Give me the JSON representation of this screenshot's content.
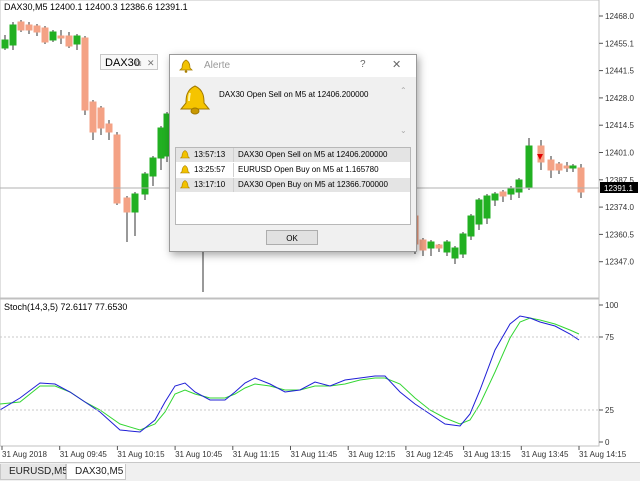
{
  "chart_header": "DAX30,M5  12400.1 12400.3 12386.6 12391.1",
  "price_axis": {
    "ticks": [
      "12468.0",
      "12455.1",
      "12441.5",
      "12428.0",
      "12414.5",
      "12401.0",
      "12387.5",
      "12374.0",
      "12360.5",
      "12347.0"
    ],
    "current_price": "12391.1",
    "current_color": "#000000"
  },
  "time_axis": {
    "ticks": [
      "31 Aug 2018",
      "31 Aug 09:45",
      "31 Aug 10:15",
      "31 Aug 10:45",
      "31 Aug 11:15",
      "31 Aug 11:45",
      "31 Aug 12:15",
      "31 Aug 12:45",
      "31 Aug 13:15",
      "31 Aug 13:45",
      "31 Aug 14:15"
    ]
  },
  "stoch": {
    "label": "Stoch(14,3,5) 72.6117 77.6530",
    "levels": [
      "100",
      "75",
      "25",
      "0"
    ],
    "main_color": "#1f1fd6",
    "signal_color": "#33d633"
  },
  "candle_colors": {
    "bull": "#22b022",
    "bear": "#f4a285"
  },
  "object_label": {
    "text": "DAX30",
    "icons": [
      "restore-icon",
      "close-icon"
    ]
  },
  "alert": {
    "title": "Alerte",
    "help": "?",
    "close": "✕",
    "message": "DAX30 Open Sell on M5 at 12406.200000",
    "log": [
      {
        "time": "13:57:13",
        "message": "DAX30 Open Sell on M5 at 12406.200000"
      },
      {
        "time": "13:25:57",
        "message": "EURUSD Open Buy on M5 at 1.165780"
      },
      {
        "time": "13:17:10",
        "message": "DAX30 Open Buy on M5 at 12366.700000"
      }
    ],
    "ok_label": "OK"
  },
  "tabs": [
    {
      "label": "EURUSD,M5",
      "active": false
    },
    {
      "label": "DAX30,M5",
      "active": true
    }
  ]
}
